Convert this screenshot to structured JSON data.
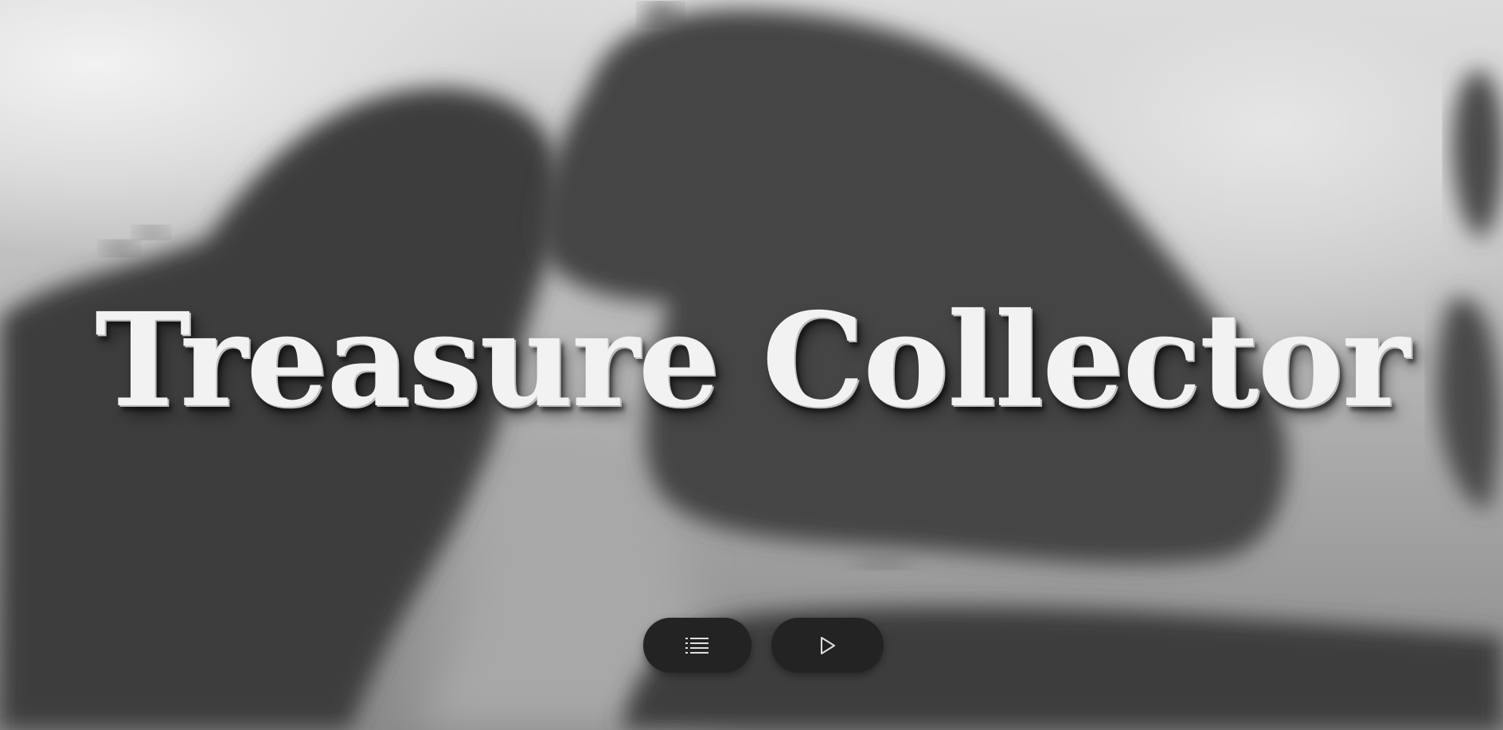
{
  "game": {
    "title": "Treasure Collector"
  },
  "menu": {
    "buttons": [
      {
        "id": "list",
        "icon": "list-icon"
      },
      {
        "id": "play",
        "icon": "play-icon"
      }
    ]
  },
  "colors": {
    "title_text": "#f2f2f2",
    "button_bg": "#232323",
    "icon": "#e0e0e0"
  }
}
